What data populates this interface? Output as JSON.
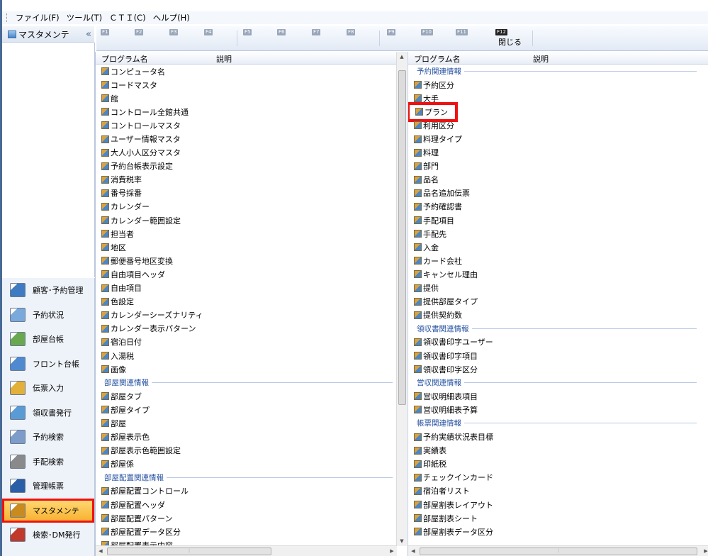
{
  "menu": [
    {
      "label": "ファイル(F)"
    },
    {
      "label": "ツール(T)"
    },
    {
      "label": "ＣＴＩ(C)"
    },
    {
      "label": "ヘルプ(H)"
    }
  ],
  "nav": {
    "title": "マスタメンテ",
    "collapse_glyph": "«",
    "items": [
      {
        "label": "顧客･予約管理",
        "icon": "customer-icon",
        "color": "#3f7bc2"
      },
      {
        "label": "予約状況",
        "icon": "calendar-icon",
        "color": "#7aa9db"
      },
      {
        "label": "部屋台帳",
        "icon": "room-ledger-icon",
        "color": "#6aa84f"
      },
      {
        "label": "フロント台帳",
        "icon": "front-ledger-icon",
        "color": "#4f8ad1"
      },
      {
        "label": "伝票入力",
        "icon": "slip-input-icon",
        "color": "#e3b13a"
      },
      {
        "label": "領収書発行",
        "icon": "receipt-icon",
        "color": "#5b9bd5"
      },
      {
        "label": "予約検索",
        "icon": "reservation-search-icon",
        "color": "#7d9cc9"
      },
      {
        "label": "手配検索",
        "icon": "arrangement-search-icon",
        "color": "#8a8a8a"
      },
      {
        "label": "管理帳票",
        "icon": "management-report-icon",
        "color": "#2a5fa8"
      },
      {
        "label": "マスタメンテ",
        "icon": "master-maintenance-icon",
        "color": "#c98a1e",
        "selected": true
      },
      {
        "label": "検索･DM発行",
        "icon": "search-dm-icon",
        "color": "#c0392b"
      }
    ]
  },
  "fkeys": [
    {
      "key": "F1",
      "label": ""
    },
    {
      "key": "F2",
      "label": ""
    },
    {
      "key": "F3",
      "label": ""
    },
    {
      "key": "F4",
      "label": ""
    },
    {
      "key": "F5",
      "label": ""
    },
    {
      "key": "F6",
      "label": ""
    },
    {
      "key": "F7",
      "label": ""
    },
    {
      "key": "F8",
      "label": ""
    },
    {
      "key": "F9",
      "label": ""
    },
    {
      "key": "F10",
      "label": ""
    },
    {
      "key": "F11",
      "label": ""
    },
    {
      "key": "F12",
      "label": "閉じる"
    }
  ],
  "left_panel": {
    "col_program": "プログラム名",
    "col_desc": "説明",
    "rows": [
      {
        "type": "item",
        "text": "コンピュータ名"
      },
      {
        "type": "item",
        "text": "コードマスタ"
      },
      {
        "type": "item",
        "text": "館"
      },
      {
        "type": "item",
        "text": "コントロール全館共通"
      },
      {
        "type": "item",
        "text": "コントロールマスタ"
      },
      {
        "type": "item",
        "text": "ユーザー情報マスタ"
      },
      {
        "type": "item",
        "text": "大人小人区分マスタ"
      },
      {
        "type": "item",
        "text": "予約台帳表示設定"
      },
      {
        "type": "item",
        "text": "消費税率"
      },
      {
        "type": "item",
        "text": "番号採番"
      },
      {
        "type": "item",
        "text": "カレンダー"
      },
      {
        "type": "item",
        "text": "カレンダー範囲設定"
      },
      {
        "type": "item",
        "text": "担当者"
      },
      {
        "type": "item",
        "text": "地区"
      },
      {
        "type": "item",
        "text": "郵便番号地区変換"
      },
      {
        "type": "item",
        "text": "自由項目ヘッダ"
      },
      {
        "type": "item",
        "text": "自由項目"
      },
      {
        "type": "item",
        "text": "色設定"
      },
      {
        "type": "item",
        "text": "カレンダーシーズナリティ"
      },
      {
        "type": "item",
        "text": "カレンダー表示パターン"
      },
      {
        "type": "item",
        "text": "宿泊日付"
      },
      {
        "type": "item",
        "text": "入湯税"
      },
      {
        "type": "item",
        "text": "画像"
      },
      {
        "type": "group",
        "text": "部屋関連情報"
      },
      {
        "type": "item",
        "text": "部屋タブ"
      },
      {
        "type": "item",
        "text": "部屋タイプ"
      },
      {
        "type": "item",
        "text": "部屋"
      },
      {
        "type": "item",
        "text": "部屋表示色"
      },
      {
        "type": "item",
        "text": "部屋表示色範囲設定"
      },
      {
        "type": "item",
        "text": "部屋係"
      },
      {
        "type": "group",
        "text": "部屋配置関連情報"
      },
      {
        "type": "item",
        "text": "部屋配置コントロール"
      },
      {
        "type": "item",
        "text": "部屋配置ヘッダ"
      },
      {
        "type": "item",
        "text": "部屋配置パターン"
      },
      {
        "type": "item",
        "text": "部屋配置データ区分"
      },
      {
        "type": "item",
        "text": "部屋配置表示内容"
      }
    ]
  },
  "right_panel": {
    "col_program": "プログラム名",
    "col_desc": "説明",
    "rows": [
      {
        "type": "group",
        "text": "予約関連情報"
      },
      {
        "type": "item",
        "text": "予約区分"
      },
      {
        "type": "item",
        "text": "大手"
      },
      {
        "type": "item",
        "text": "プラン",
        "highlight": true
      },
      {
        "type": "item",
        "text": "利用区分"
      },
      {
        "type": "item",
        "text": "料理タイプ"
      },
      {
        "type": "item",
        "text": "料理"
      },
      {
        "type": "item",
        "text": "部門"
      },
      {
        "type": "item",
        "text": "品名"
      },
      {
        "type": "item",
        "text": "品名追加伝票"
      },
      {
        "type": "item",
        "text": "予約確認書"
      },
      {
        "type": "item",
        "text": "手配項目"
      },
      {
        "type": "item",
        "text": "手配先"
      },
      {
        "type": "item",
        "text": "入金"
      },
      {
        "type": "item",
        "text": "カード会社"
      },
      {
        "type": "item",
        "text": "キャンセル理由"
      },
      {
        "type": "item",
        "text": "提供"
      },
      {
        "type": "item",
        "text": "提供部屋タイプ"
      },
      {
        "type": "item",
        "text": "提供契約数"
      },
      {
        "type": "group",
        "text": "領収書関連情報"
      },
      {
        "type": "item",
        "text": "領収書印字ユーザー"
      },
      {
        "type": "item",
        "text": "領収書印字項目"
      },
      {
        "type": "item",
        "text": "領収書印字区分"
      },
      {
        "type": "group",
        "text": "営収関連情報"
      },
      {
        "type": "item",
        "text": "営収明細表項目"
      },
      {
        "type": "item",
        "text": "営収明細表予算"
      },
      {
        "type": "group",
        "text": "帳票関連情報"
      },
      {
        "type": "item",
        "text": "予約実績状況表目標"
      },
      {
        "type": "item",
        "text": "実績表"
      },
      {
        "type": "item",
        "text": "印紙税"
      },
      {
        "type": "item",
        "text": "チェックインカード"
      },
      {
        "type": "item",
        "text": "宿泊者リスト"
      },
      {
        "type": "item",
        "text": "部屋割表レイアウト"
      },
      {
        "type": "item",
        "text": "部屋割表シート"
      },
      {
        "type": "item",
        "text": "部屋割表データ区分"
      }
    ]
  }
}
